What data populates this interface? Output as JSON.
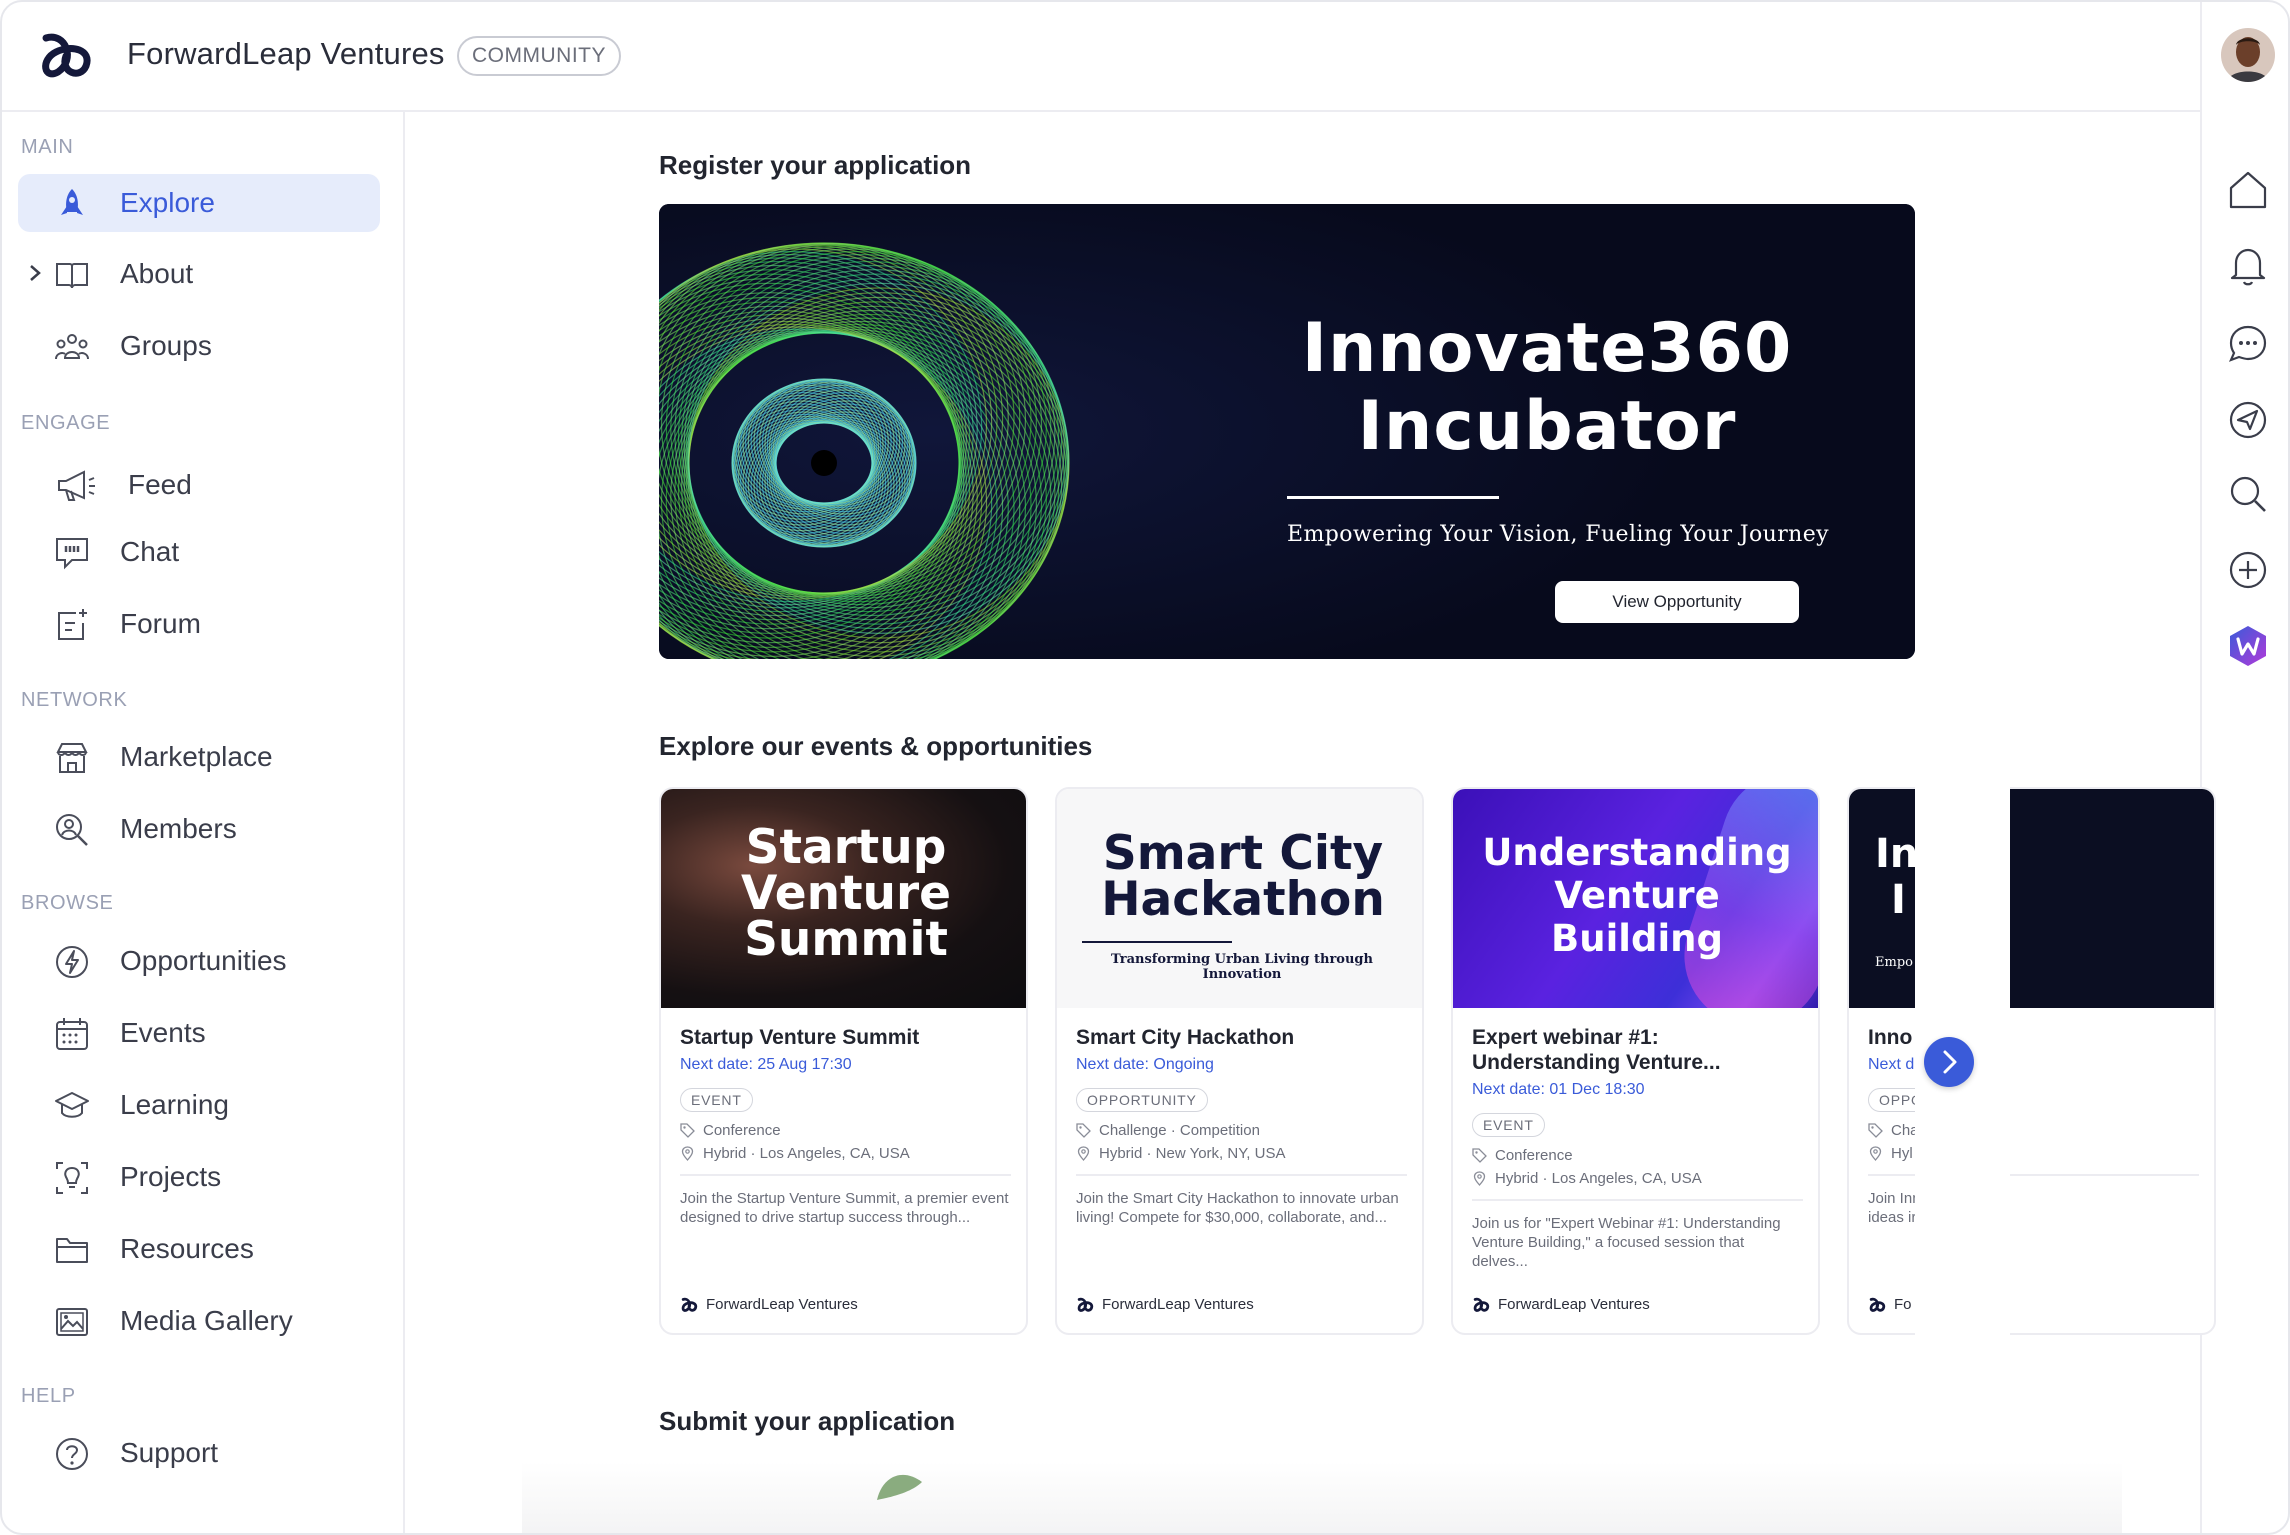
{
  "header": {
    "brand": "ForwardLeap Ventures",
    "badge": "COMMUNITY"
  },
  "sidebar": {
    "sections": {
      "main": "MAIN",
      "engage": "ENGAGE",
      "network": "NETWORK",
      "browse": "BROWSE",
      "help": "HELP"
    },
    "items": {
      "explore": "Explore",
      "about": "About",
      "groups": "Groups",
      "feed": "Feed",
      "chat": "Chat",
      "forum": "Forum",
      "marketplace": "Marketplace",
      "members": "Members",
      "opportunities": "Opportunities",
      "events": "Events",
      "learning": "Learning",
      "projects": "Projects",
      "resources": "Resources",
      "media_gallery": "Media Gallery",
      "support": "Support"
    },
    "active": "explore"
  },
  "main": {
    "register_heading": "Register your application",
    "banner": {
      "title_line1": "Innovate360",
      "title_line2": "Incubator",
      "subtitle": "Empowering Your Vision, Fueling Your Journey",
      "button": "View Opportunity"
    },
    "explore_heading": "Explore our events & opportunities",
    "submit_heading": "Submit your application",
    "cards": [
      {
        "image_text": [
          "Startup",
          "Venture",
          "Summit"
        ],
        "title": "Startup Venture Summit",
        "date": "Next date: 25 Aug 17:30",
        "badge": "EVENT",
        "category": "Conference",
        "location": "Hybrid · Los Angeles, CA, USA",
        "description": "Join the Startup Venture Summit, a premier event designed to drive startup success through...",
        "organizer": "ForwardLeap Ventures"
      },
      {
        "image_text": [
          "Smart City",
          "Hackathon"
        ],
        "image_subtitle": "Transforming Urban Living through Innovation",
        "title": "Smart City Hackathon",
        "date": "Next date: Ongoing",
        "badge": "OPPORTUNITY",
        "category": "Challenge · Competition",
        "location": "Hybrid · New York, NY, USA",
        "description": "Join the Smart City Hackathon to innovate urban living! Compete for $30,000, collaborate, and...",
        "organizer": "ForwardLeap Ventures"
      },
      {
        "image_text": [
          "Understanding",
          "Venture",
          "Building"
        ],
        "title": "Expert webinar #1: Understanding Venture...",
        "date": "Next date: 01 Dec 18:30",
        "badge": "EVENT",
        "category": "Conference",
        "location": "Hybrid · Los Angeles, CA, USA",
        "description": "Join us for \"Expert Webinar #1: Understanding Venture Building,\" a focused session that delves...",
        "organizer": "ForwardLeap Ventures"
      },
      {
        "image_text": [
          "In",
          "I"
        ],
        "image_subtitle": "Empo",
        "title": "Inno",
        "date": "Next d",
        "badge": "OPPO",
        "category": "Cha",
        "location": "Hyl",
        "description": "Join Inn ideas ir",
        "organizer": "Fo"
      }
    ]
  },
  "colors": {
    "accent": "#3a5bd9",
    "active_bg": "#e6ecfb",
    "banner_bg": "#0b0e22"
  },
  "rail_icons": [
    "home-icon",
    "bell-icon",
    "chat-bubble-icon",
    "send-icon",
    "search-icon",
    "plus-circle-icon",
    "w-app-icon"
  ]
}
